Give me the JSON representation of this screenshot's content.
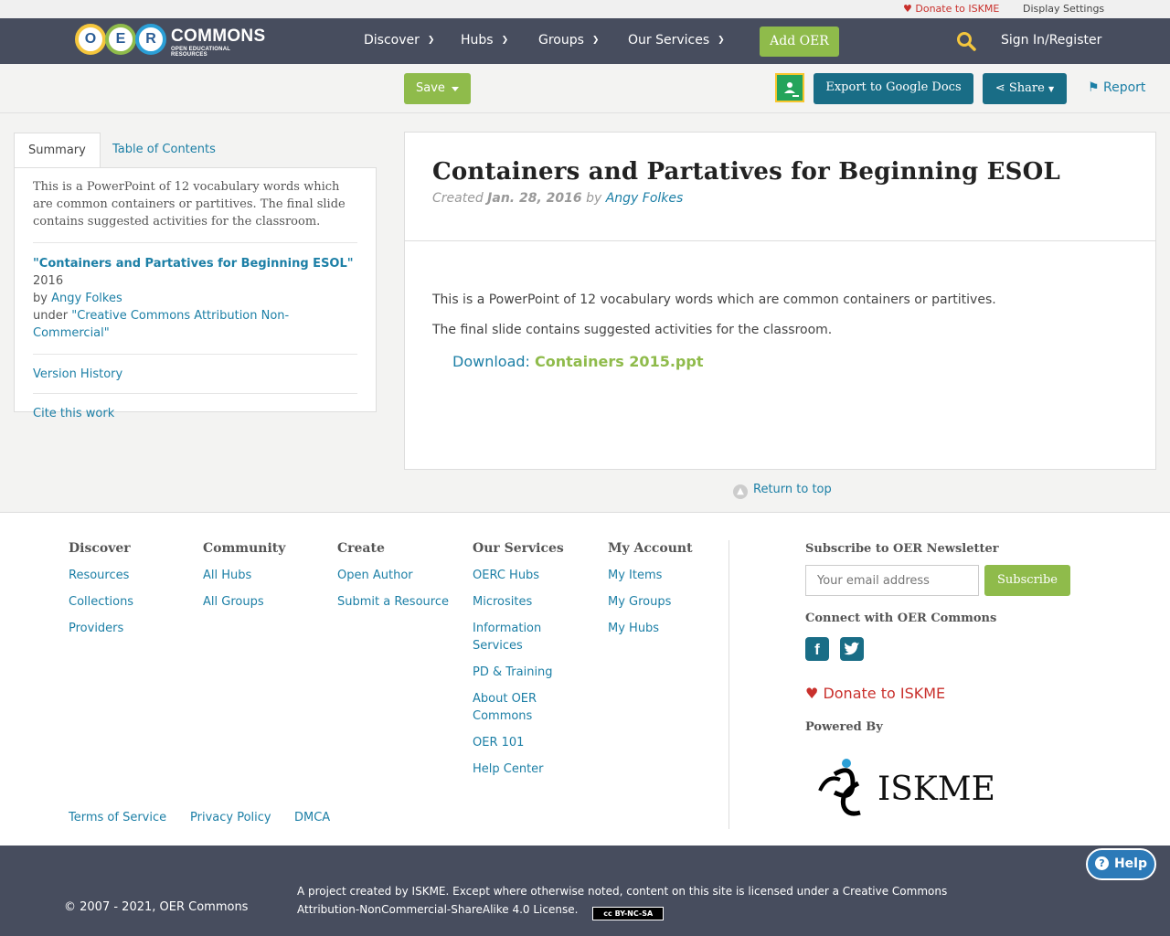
{
  "utility": {
    "donate": "Donate to ISKME",
    "display_settings": "Display Settings"
  },
  "logo": {
    "o": "O",
    "e": "E",
    "r": "R",
    "wordmark": "COMMONS",
    "sub": "OPEN EDUCATIONAL RESOURCES"
  },
  "nav": {
    "discover": "Discover",
    "hubs": "Hubs",
    "groups": "Groups",
    "services": "Our Services",
    "add_oer": "Add OER",
    "signin": "Sign In/Register"
  },
  "actions": {
    "save": "Save",
    "export": "Export to Google Docs",
    "share": "Share",
    "report": "Report"
  },
  "tabs": {
    "summary": "Summary",
    "toc": "Table of Contents"
  },
  "sidebar": {
    "summary": "This is a PowerPoint of 12 vocabulary words which are common containers or partitives. The final slide contains suggested activities for the classroom.",
    "work_title": "\"Containers and Partatives for Beginning ESOL\"",
    "year": "2016",
    "by": "by",
    "author": "Angy Folkes",
    "under": "under",
    "license": "\"Creative Commons Attribution Non-Commercial\"",
    "version_history": "Version History",
    "cite": "Cite this work"
  },
  "resource": {
    "title": "Containers and Partatives for Beginning ESOL",
    "created_label": "Created",
    "date": "Jan. 28, 2016",
    "by": "by",
    "author": "Angy Folkes",
    "para1": "This is a PowerPoint of 12 vocabulary words which are common containers or partitives.",
    "para2": "The final slide contains suggested activities for the classroom.",
    "download_label": "Download:",
    "download_file": "Containers 2015.ppt"
  },
  "return_top": "Return to top",
  "footer": {
    "discover": {
      "title": "Discover",
      "links": [
        "Resources",
        "Collections",
        "Providers"
      ]
    },
    "community": {
      "title": "Community",
      "links": [
        "All Hubs",
        "All Groups"
      ]
    },
    "create": {
      "title": "Create",
      "links": [
        "Open Author",
        "Submit a Resource"
      ]
    },
    "services": {
      "title": "Our Services",
      "links": [
        "OERC Hubs",
        "Microsites",
        "Information Services",
        "PD & Training",
        "About OER Commons",
        "OER 101",
        "Help Center"
      ]
    },
    "account": {
      "title": "My Account",
      "links": [
        "My Items",
        "My Groups",
        "My Hubs"
      ]
    },
    "newsletter_title": "Subscribe to OER Newsletter",
    "email_placeholder": "Your email address",
    "subscribe": "Subscribe",
    "connect_title": "Connect with OER Commons",
    "donate": "Donate to ISKME",
    "powered_by": "Powered By",
    "iskme": "ISKME",
    "terms": "Terms of Service",
    "privacy": "Privacy Policy",
    "dmca": "DMCA"
  },
  "bottom": {
    "copyright": "© 2007 - 2021, OER Commons",
    "license": "A project created by ISKME. Except where otherwise noted, content on this site is licensed under a Creative Commons Attribution-NonCommercial-ShareAlike 4.0 License.",
    "cc_badge": "cc BY-NC-SA",
    "help": "Help"
  }
}
